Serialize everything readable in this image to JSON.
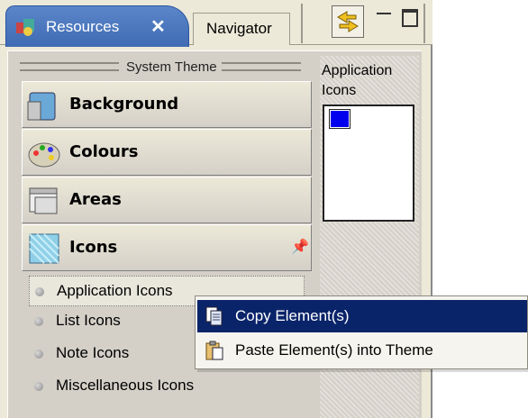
{
  "tabs": [
    {
      "label": "Resources",
      "active": true
    },
    {
      "label": "Navigator",
      "active": false
    }
  ],
  "theme_header": "System Theme",
  "sections": [
    {
      "label": "Background",
      "icon": "background-icon"
    },
    {
      "label": "Colours",
      "icon": "palette-icon"
    },
    {
      "label": "Areas",
      "icon": "areas-icon"
    },
    {
      "label": "Icons",
      "icon": "icons-icon"
    }
  ],
  "list_items": [
    {
      "label": "Application Icons",
      "selected": true
    },
    {
      "label": "List Icons",
      "selected": false
    },
    {
      "label": "Note Icons",
      "selected": false
    },
    {
      "label": "Miscellaneous Icons",
      "selected": false
    }
  ],
  "preview_label": "Application Icons",
  "context_menu": [
    {
      "label": "Copy Element(s)",
      "highlighted": true
    },
    {
      "label": "Paste Element(s) into Theme",
      "highlighted": false
    }
  ],
  "colors": {
    "tab_active": "#3f6bb4",
    "menu_highlight": "#0a246a",
    "preview_swatch": "#0000ee"
  }
}
